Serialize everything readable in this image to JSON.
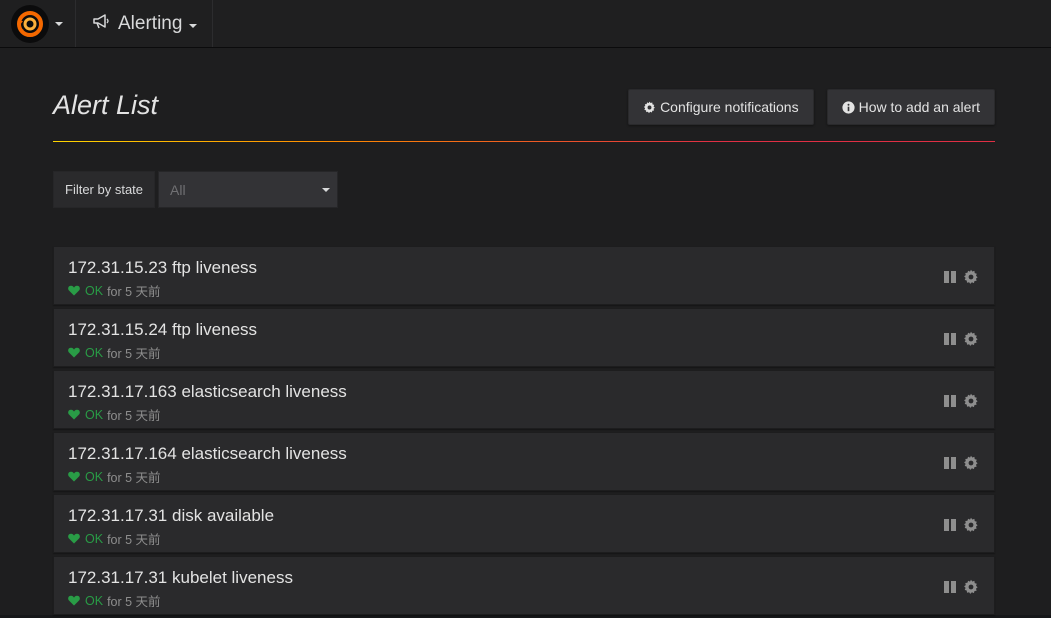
{
  "navbar": {
    "section_title": "Alerting"
  },
  "page": {
    "title": "Alert List",
    "configure_label": "Configure notifications",
    "howto_label": "How to add an alert"
  },
  "filter": {
    "label": "Filter by state",
    "value": "All"
  },
  "alerts": [
    {
      "name": "172.31.15.23 ftp liveness",
      "state": "OK",
      "duration": "for 5 天前"
    },
    {
      "name": "172.31.15.24 ftp liveness",
      "state": "OK",
      "duration": "for 5 天前"
    },
    {
      "name": "172.31.17.163 elasticsearch liveness",
      "state": "OK",
      "duration": "for 5 天前"
    },
    {
      "name": "172.31.17.164 elasticsearch liveness",
      "state": "OK",
      "duration": "for 5 天前"
    },
    {
      "name": "172.31.17.31 disk available",
      "state": "OK",
      "duration": "for 5 天前"
    },
    {
      "name": "172.31.17.31 kubelet liveness",
      "state": "OK",
      "duration": "for 5 天前"
    }
  ],
  "colors": {
    "ok": "#299c46",
    "accent_gradient": [
      "#ffd500",
      "#ff8a00",
      "#e02f44"
    ],
    "logo": "#f46800"
  },
  "icons": {
    "logo": "grafana-logo-icon",
    "section": "megaphone-icon",
    "configure": "gear-icon",
    "howto": "info-circle-icon",
    "state": "heart-icon",
    "pause": "pause-icon",
    "edit": "gear-icon"
  }
}
